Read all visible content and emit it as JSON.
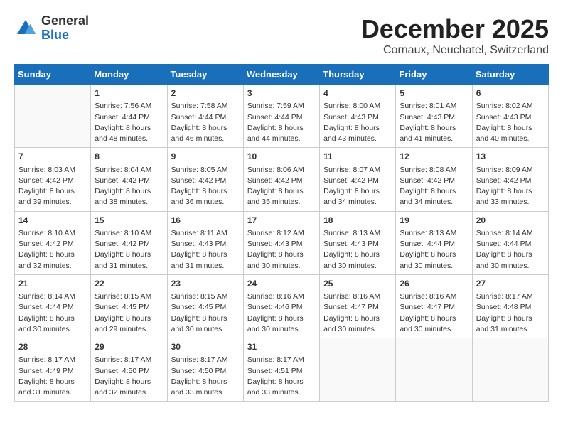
{
  "logo": {
    "general": "General",
    "blue": "Blue"
  },
  "title": "December 2025",
  "subtitle": "Cornaux, Neuchatel, Switzerland",
  "header_days": [
    "Sunday",
    "Monday",
    "Tuesday",
    "Wednesday",
    "Thursday",
    "Friday",
    "Saturday"
  ],
  "weeks": [
    [
      {
        "day": "",
        "info": ""
      },
      {
        "day": "1",
        "info": "Sunrise: 7:56 AM\nSunset: 4:44 PM\nDaylight: 8 hours\nand 48 minutes."
      },
      {
        "day": "2",
        "info": "Sunrise: 7:58 AM\nSunset: 4:44 PM\nDaylight: 8 hours\nand 46 minutes."
      },
      {
        "day": "3",
        "info": "Sunrise: 7:59 AM\nSunset: 4:44 PM\nDaylight: 8 hours\nand 44 minutes."
      },
      {
        "day": "4",
        "info": "Sunrise: 8:00 AM\nSunset: 4:43 PM\nDaylight: 8 hours\nand 43 minutes."
      },
      {
        "day": "5",
        "info": "Sunrise: 8:01 AM\nSunset: 4:43 PM\nDaylight: 8 hours\nand 41 minutes."
      },
      {
        "day": "6",
        "info": "Sunrise: 8:02 AM\nSunset: 4:43 PM\nDaylight: 8 hours\nand 40 minutes."
      }
    ],
    [
      {
        "day": "7",
        "info": "Sunrise: 8:03 AM\nSunset: 4:42 PM\nDaylight: 8 hours\nand 39 minutes."
      },
      {
        "day": "8",
        "info": "Sunrise: 8:04 AM\nSunset: 4:42 PM\nDaylight: 8 hours\nand 38 minutes."
      },
      {
        "day": "9",
        "info": "Sunrise: 8:05 AM\nSunset: 4:42 PM\nDaylight: 8 hours\nand 36 minutes."
      },
      {
        "day": "10",
        "info": "Sunrise: 8:06 AM\nSunset: 4:42 PM\nDaylight: 8 hours\nand 35 minutes."
      },
      {
        "day": "11",
        "info": "Sunrise: 8:07 AM\nSunset: 4:42 PM\nDaylight: 8 hours\nand 34 minutes."
      },
      {
        "day": "12",
        "info": "Sunrise: 8:08 AM\nSunset: 4:42 PM\nDaylight: 8 hours\nand 34 minutes."
      },
      {
        "day": "13",
        "info": "Sunrise: 8:09 AM\nSunset: 4:42 PM\nDaylight: 8 hours\nand 33 minutes."
      }
    ],
    [
      {
        "day": "14",
        "info": "Sunrise: 8:10 AM\nSunset: 4:42 PM\nDaylight: 8 hours\nand 32 minutes."
      },
      {
        "day": "15",
        "info": "Sunrise: 8:10 AM\nSunset: 4:42 PM\nDaylight: 8 hours\nand 31 minutes."
      },
      {
        "day": "16",
        "info": "Sunrise: 8:11 AM\nSunset: 4:43 PM\nDaylight: 8 hours\nand 31 minutes."
      },
      {
        "day": "17",
        "info": "Sunrise: 8:12 AM\nSunset: 4:43 PM\nDaylight: 8 hours\nand 30 minutes."
      },
      {
        "day": "18",
        "info": "Sunrise: 8:13 AM\nSunset: 4:43 PM\nDaylight: 8 hours\nand 30 minutes."
      },
      {
        "day": "19",
        "info": "Sunrise: 8:13 AM\nSunset: 4:44 PM\nDaylight: 8 hours\nand 30 minutes."
      },
      {
        "day": "20",
        "info": "Sunrise: 8:14 AM\nSunset: 4:44 PM\nDaylight: 8 hours\nand 30 minutes."
      }
    ],
    [
      {
        "day": "21",
        "info": "Sunrise: 8:14 AM\nSunset: 4:44 PM\nDaylight: 8 hours\nand 30 minutes."
      },
      {
        "day": "22",
        "info": "Sunrise: 8:15 AM\nSunset: 4:45 PM\nDaylight: 8 hours\nand 29 minutes."
      },
      {
        "day": "23",
        "info": "Sunrise: 8:15 AM\nSunset: 4:45 PM\nDaylight: 8 hours\nand 30 minutes."
      },
      {
        "day": "24",
        "info": "Sunrise: 8:16 AM\nSunset: 4:46 PM\nDaylight: 8 hours\nand 30 minutes."
      },
      {
        "day": "25",
        "info": "Sunrise: 8:16 AM\nSunset: 4:47 PM\nDaylight: 8 hours\nand 30 minutes."
      },
      {
        "day": "26",
        "info": "Sunrise: 8:16 AM\nSunset: 4:47 PM\nDaylight: 8 hours\nand 30 minutes."
      },
      {
        "day": "27",
        "info": "Sunrise: 8:17 AM\nSunset: 4:48 PM\nDaylight: 8 hours\nand 31 minutes."
      }
    ],
    [
      {
        "day": "28",
        "info": "Sunrise: 8:17 AM\nSunset: 4:49 PM\nDaylight: 8 hours\nand 31 minutes."
      },
      {
        "day": "29",
        "info": "Sunrise: 8:17 AM\nSunset: 4:50 PM\nDaylight: 8 hours\nand 32 minutes."
      },
      {
        "day": "30",
        "info": "Sunrise: 8:17 AM\nSunset: 4:50 PM\nDaylight: 8 hours\nand 33 minutes."
      },
      {
        "day": "31",
        "info": "Sunrise: 8:17 AM\nSunset: 4:51 PM\nDaylight: 8 hours\nand 33 minutes."
      },
      {
        "day": "",
        "info": ""
      },
      {
        "day": "",
        "info": ""
      },
      {
        "day": "",
        "info": ""
      }
    ]
  ]
}
